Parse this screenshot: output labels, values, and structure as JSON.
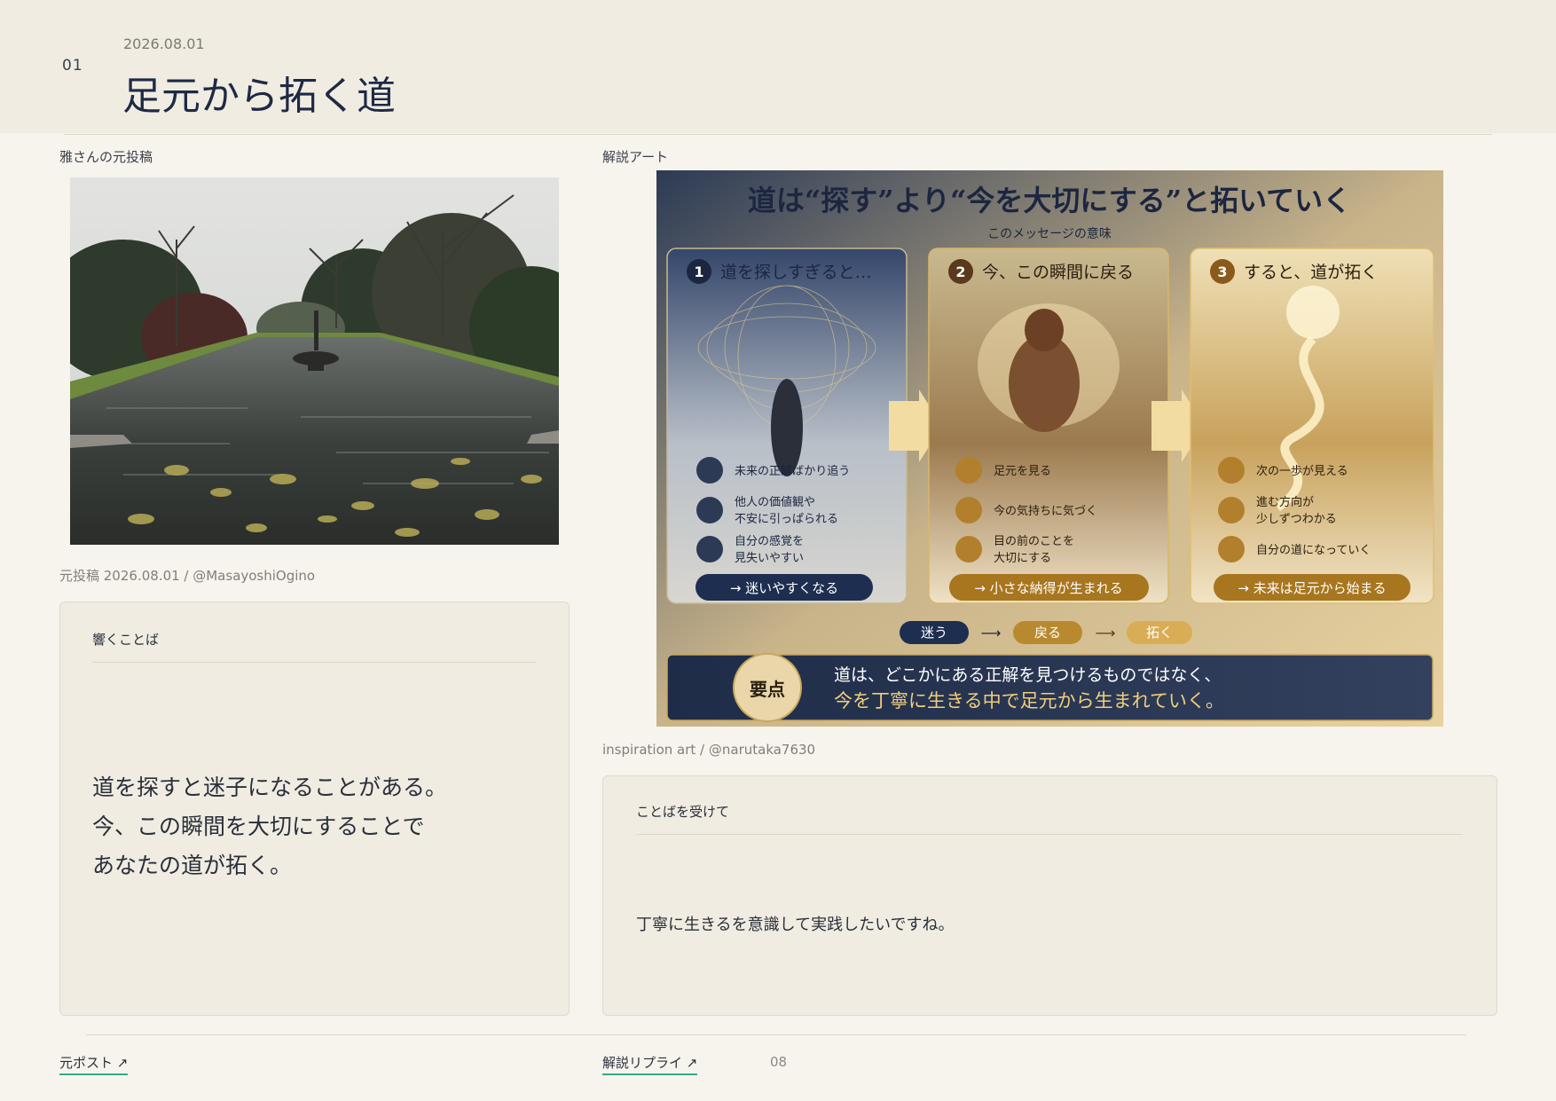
{
  "header": {
    "number": "01",
    "date": "2026.08.01",
    "title": "足元から拓く道"
  },
  "original": {
    "label": "雅さんの元投稿",
    "credit": "元投稿 2026.08.01 / @MasayoshiOgino"
  },
  "art": {
    "label": "解説アート",
    "credit": "inspiration art / @narutaka7630",
    "headline": "道は“探す”より“今を大切にする”と拓いていく",
    "subhead": "このメッセージの意味",
    "panels": [
      {
        "num": "1",
        "title": "道を探しすぎると…",
        "items": [
          "未来の正解ばかり追う",
          "他人の価値観や",
          "不安に引っぱられる",
          "自分の感覚を",
          "見失いやすい"
        ],
        "result": "→ 迷いやすくなる"
      },
      {
        "num": "2",
        "title": "今、この瞬間に戻る",
        "items": [
          "足元を見る",
          "今の気持ちに気づく",
          "目の前のことを",
          "大切にする"
        ],
        "result": "→ 小さな納得が生まれる"
      },
      {
        "num": "3",
        "title": "すると、道が拓く",
        "items": [
          "次の一歩が見える",
          "進む方向が",
          "少しずつわかる",
          "自分の道になっていく"
        ],
        "result": "→ 未来は足元から始まる"
      }
    ],
    "flow": [
      "迷う",
      "戻る",
      "拓く"
    ],
    "key_badge": "要点",
    "key_line1": "道は、どこかにある正解を見つけるものではなく、",
    "key_line2": "今を丁寧に生きる中で足元から生まれていく。"
  },
  "quote_card": {
    "heading": "響くことば",
    "lines": [
      "道を探すと迷子になることがある。",
      "今、この瞬間を大切にすることで",
      "あなたの道が拓く。"
    ]
  },
  "reply_card": {
    "heading": "ことばを受けて",
    "text": "丁寧に生きるを意識して実践したいですね。"
  },
  "footer": {
    "original_link": "元ポスト ↗",
    "reply_link": "解説リプライ ↗",
    "page": "08"
  }
}
